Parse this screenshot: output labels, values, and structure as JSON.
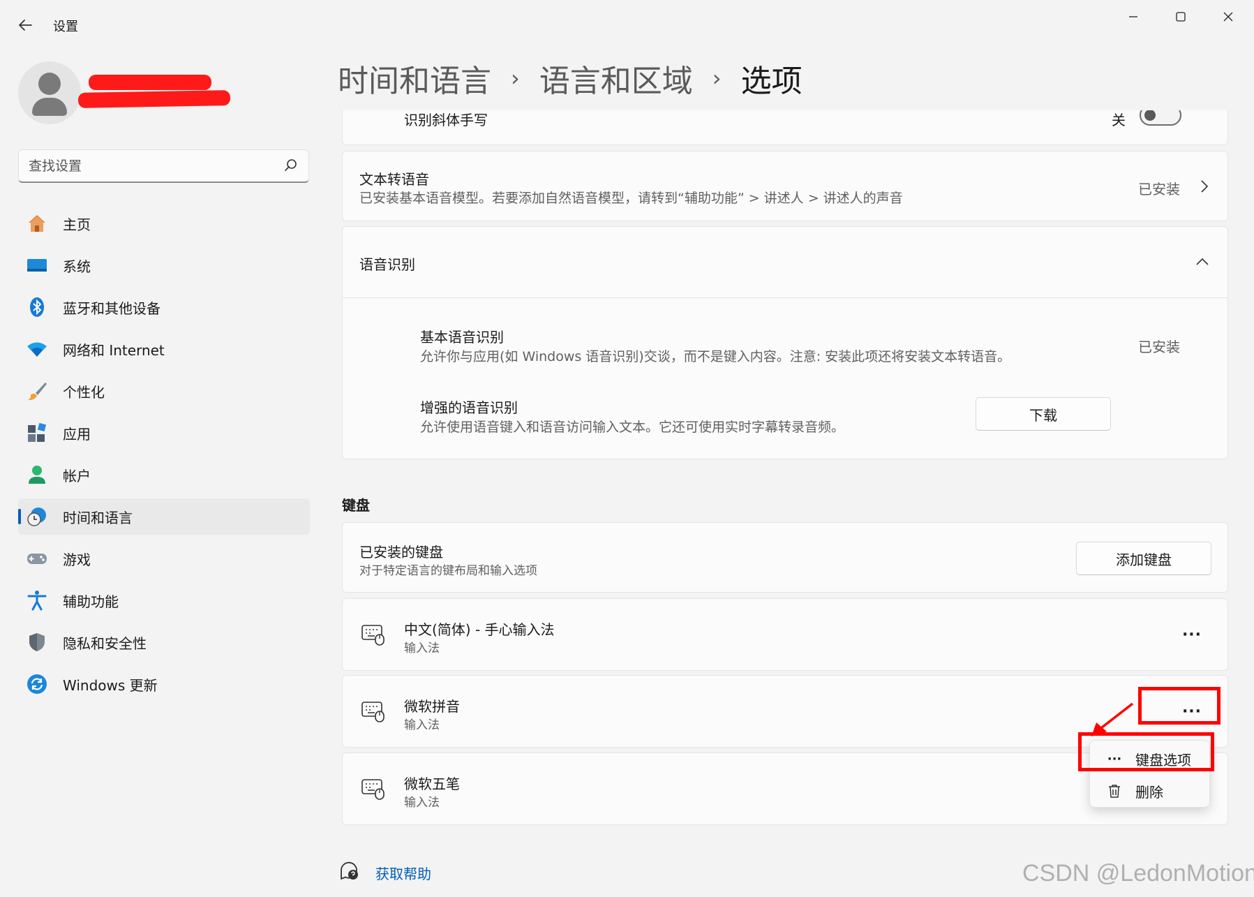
{
  "app": {
    "title": "设置"
  },
  "window_controls": {
    "minimize": "—",
    "maximize": "☐",
    "close": "✕"
  },
  "search": {
    "placeholder": "查找设置"
  },
  "sidebar": {
    "items": [
      {
        "label": "主页",
        "icon": "home-icon",
        "active": false
      },
      {
        "label": "系统",
        "icon": "system-icon",
        "active": false
      },
      {
        "label": "蓝牙和其他设备",
        "icon": "bluetooth-icon",
        "active": false
      },
      {
        "label": "网络和 Internet",
        "icon": "wifi-icon",
        "active": false
      },
      {
        "label": "个性化",
        "icon": "brush-icon",
        "active": false
      },
      {
        "label": "应用",
        "icon": "apps-icon",
        "active": false
      },
      {
        "label": "帐户",
        "icon": "account-icon",
        "active": false
      },
      {
        "label": "时间和语言",
        "icon": "time-language-icon",
        "active": true
      },
      {
        "label": "游戏",
        "icon": "gamepad-icon",
        "active": false
      },
      {
        "label": "辅助功能",
        "icon": "accessibility-icon",
        "active": false
      },
      {
        "label": "隐私和安全性",
        "icon": "shield-icon",
        "active": false
      },
      {
        "label": "Windows 更新",
        "icon": "update-icon",
        "active": false
      }
    ]
  },
  "breadcrumb": {
    "level1": "时间和语言",
    "level2": "语言和区域",
    "current": "选项",
    "separator": "›"
  },
  "handwriting": {
    "title": "识别斜体手写",
    "state": "关"
  },
  "tts": {
    "title": "文本转语音",
    "desc": "已安装基本语音模型。若要添加自然语音模型，请转到“辅助功能” > 讲述人 > 讲述人的声音",
    "status": "已安装"
  },
  "speech": {
    "title": "语音识别",
    "basic_title": "基本语音识别",
    "basic_desc": "允许你与应用(如 Windows 语音识别)交谈，而不是键入内容。注意: 安装此项还将安装文本转语音。",
    "basic_status": "已安装",
    "enhanced_title": "增强的语音识别",
    "enhanced_desc": "允许使用语音键入和语音访问输入文本。它还可使用实时字幕转录音频。",
    "download_label": "下载"
  },
  "keyboard": {
    "section": "键盘",
    "installed_title": "已安装的键盘",
    "installed_desc": "对于特定语言的键布局和输入选项",
    "add_label": "添加键盘",
    "items": [
      {
        "name": "中文(简体) - 手心输入法",
        "type": "输入法"
      },
      {
        "name": "微软拼音",
        "type": "输入法"
      },
      {
        "name": "微软五笔",
        "type": "输入法"
      }
    ],
    "more_label": "···"
  },
  "context_menu": {
    "items": [
      {
        "label": "键盘选项",
        "icon": "more-icon",
        "glyph": "···"
      },
      {
        "label": "删除",
        "icon": "trash-icon",
        "glyph": ""
      }
    ]
  },
  "help": {
    "label": "获取帮助"
  },
  "watermark": "CSDN @LedonMotion",
  "colors": {
    "accent": "#005fb8",
    "annotation": "#ff0000",
    "redaction": "#ff1a1a"
  }
}
